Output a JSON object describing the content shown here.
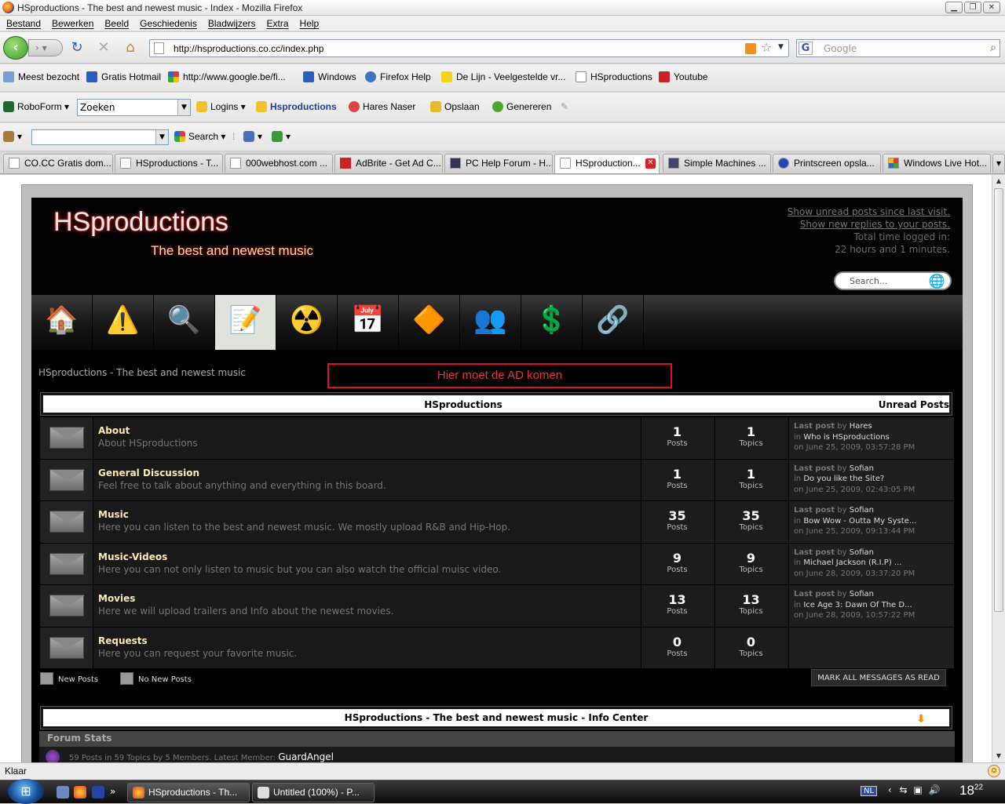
{
  "window": {
    "title": "HSproductions - The best and newest music - Index - Mozilla Firefox"
  },
  "menu": [
    "Bestand",
    "Bewerken",
    "Beeld",
    "Geschiedenis",
    "Bladwijzers",
    "Extra",
    "Help"
  ],
  "nav": {
    "url": "http://hsproductions.co.cc/index.php",
    "search_placeholder": "Google"
  },
  "bookmarks": [
    {
      "label": "Meest bezocht",
      "icon": "bookmark-icon"
    },
    {
      "label": "Gratis Hotmail",
      "icon": "msn-icon"
    },
    {
      "label": "http://www.google.be/fi...",
      "icon": "google-icon"
    },
    {
      "label": "Windows",
      "icon": "msn-icon"
    },
    {
      "label": "Firefox Help",
      "icon": "help-icon"
    },
    {
      "label": "De Lijn - Veelgestelde vr...",
      "icon": "lijn-icon"
    },
    {
      "label": "HSproductions",
      "icon": "page-icon"
    },
    {
      "label": "Youtube",
      "icon": "youtube-icon"
    }
  ],
  "roboform": {
    "brand": "RoboForm",
    "search_value": "Zoeken",
    "logins": "Logins",
    "site": "Hsproductions",
    "user": "Hares Naser",
    "save": "Opslaan",
    "generate": "Genereren"
  },
  "toolbar3": {
    "search": "Search"
  },
  "tabs": [
    {
      "label": "CO.CC Gratis dom...",
      "active": false
    },
    {
      "label": "HSproductions - T...",
      "active": false
    },
    {
      "label": "000webhost.com ...",
      "active": false
    },
    {
      "label": "AdBrite - Get Ad C...",
      "active": false
    },
    {
      "label": "PC Help Forum - H...",
      "active": false
    },
    {
      "label": "HSproduction...",
      "active": true
    },
    {
      "label": "Simple Machines ...",
      "active": false
    },
    {
      "label": "Printscreen opsla...",
      "active": false
    },
    {
      "label": "Windows Live Hot...",
      "active": false
    }
  ],
  "forum": {
    "logo": "HSproductions",
    "slogan": "The best and newest music",
    "unread_link": "Show unread posts since last visit.",
    "replies_link": "Show new replies to your posts.",
    "logged_label": "Total time logged in:",
    "logged_value": "22 hours and 1 minutes.",
    "search_placeholder": "Search...",
    "board_title": "HSproductions - The best and newest music",
    "ad_text": "Hier moet de AD komen",
    "category": "HSproductions",
    "unread_posts": "Unread Posts",
    "posts_label": "Posts",
    "topics_label": "Topics",
    "lastpost_label": "Last post",
    "by": "by",
    "in": "in",
    "boards": [
      {
        "name": "About",
        "desc": "About HSproductions",
        "posts": "1",
        "topics": "1",
        "lp_user": "Hares",
        "lp_topic": "Who is HSproductions",
        "lp_date": "on June 25, 2009, 03:57:28 PM"
      },
      {
        "name": "General Discussion",
        "desc": "Feel free to talk about anything and everything in this board.",
        "posts": "1",
        "topics": "1",
        "lp_user": "Sofian",
        "lp_topic": "Do you like the Site?",
        "lp_date": "on June 25, 2009, 02:43:05 PM"
      },
      {
        "name": "Music",
        "desc": "Here you can listen to the best and newest music. We mostly upload R&B and Hip-Hop.",
        "posts": "35",
        "topics": "35",
        "lp_user": "Sofian",
        "lp_topic": "Bow Wow - Outta My Syste...",
        "lp_date": "on June 25, 2009, 09:13:44 PM"
      },
      {
        "name": "Music-Videos",
        "desc": "Here you can not only listen to music but you can also watch the official muisc video.",
        "posts": "9",
        "topics": "9",
        "lp_user": "Sofian",
        "lp_topic": "Michael Jackson (R.I.P) ...",
        "lp_date": "on June 28, 2009, 03:37:20 PM"
      },
      {
        "name": "Movies",
        "desc": "Here we will upload trailers and Info about the newest movies.",
        "posts": "13",
        "topics": "13",
        "lp_user": "Sofian",
        "lp_topic": "Ice Age 3: Dawn Of The D...",
        "lp_date": "on June 28, 2009, 10:57:22 PM"
      },
      {
        "name": "Requests",
        "desc": "Here you can request your favorite music.",
        "posts": "0",
        "topics": "0",
        "lp_user": "",
        "lp_topic": "",
        "lp_date": ""
      }
    ],
    "legend_new": "New Posts",
    "legend_nonew": "No New Posts",
    "mark_read": "MARK ALL MESSAGES AS READ",
    "info_title": "HSproductions - The best and newest music - Info Center",
    "forum_stats": "Forum Stats",
    "stats_text": "59 Posts in 59 Topics by 5 Members. Latest Member:",
    "latest_member": "GuardAngel"
  },
  "status": "Klaar",
  "taskbar": {
    "tasks": [
      "HSproductions - Th...",
      "Untitled (100%) - P..."
    ],
    "lang": "NL",
    "time_h": "18",
    "time_m": "22"
  }
}
